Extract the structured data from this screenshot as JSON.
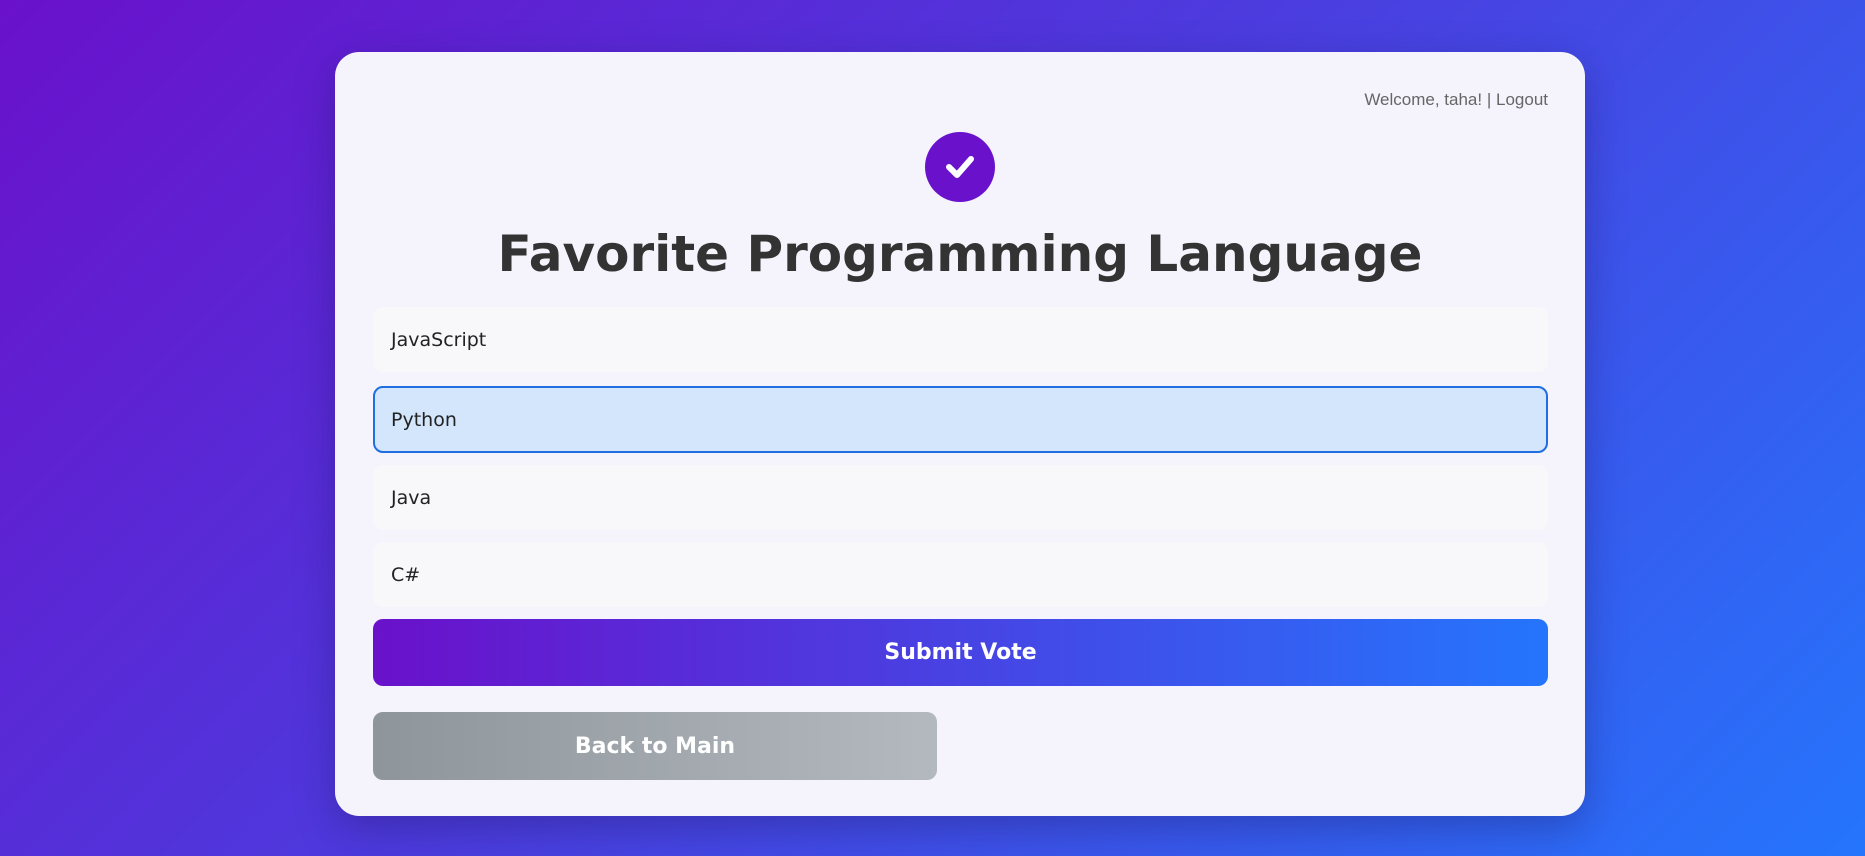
{
  "header": {
    "welcome_text": "Welcome, taha!",
    "separator": "|",
    "logout_label": "Logout"
  },
  "poll": {
    "icon": "check-icon",
    "title": "Favorite Programming Language",
    "options": [
      {
        "label": "JavaScript",
        "selected": false
      },
      {
        "label": "Python",
        "selected": true
      },
      {
        "label": "Java",
        "selected": false
      },
      {
        "label": "C#",
        "selected": false
      }
    ]
  },
  "actions": {
    "submit_label": "Submit Vote",
    "back_label": "Back to Main"
  },
  "colors": {
    "accent_start": "#6a11cb",
    "accent_end": "#2575fc",
    "selected_bg": "#d3e6fc",
    "selected_border": "#1f6fe0"
  }
}
